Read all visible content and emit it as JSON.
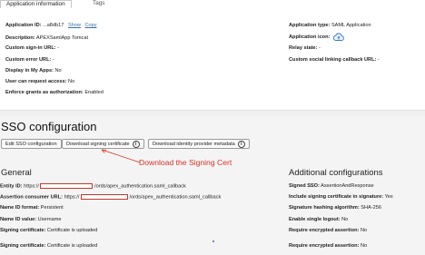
{
  "tabs": [
    {
      "label": "Application information",
      "active": true
    },
    {
      "label": "Tags",
      "active": false
    }
  ],
  "info": {
    "app_id": {
      "label": "Application ID:",
      "value": "...a8db17",
      "show": "Show",
      "copy": "Copy"
    },
    "description": {
      "label": "Description:",
      "value": "APEXSamlApp Tomcat"
    },
    "custom_signin": {
      "label": "Custom sign-in URL:",
      "value": "-"
    },
    "custom_error": {
      "label": "Custom error URL:",
      "value": "-"
    },
    "display_my_apps": {
      "label": "Display in My Apps:",
      "value": "No"
    },
    "user_request": {
      "label": "User can request access:",
      "value": "No"
    },
    "enforce_grants": {
      "label": "Enforce grants as authorization:",
      "value": "Enabled"
    },
    "app_type": {
      "label": "Application type:",
      "value": "SAML Application"
    },
    "app_icon": {
      "label": "Application icon:"
    },
    "relay_state": {
      "label": "Relay state:",
      "value": "-"
    },
    "social_callback": {
      "label": "Custom social linking callback URL:",
      "value": "-"
    }
  },
  "sso": {
    "title": "SSO configuration",
    "buttons": {
      "edit": "Edit SSO configuration",
      "download_cert": "Download signing certificate",
      "download_metadata": "Download identity provider metadata"
    },
    "annotation": "Download the Signing Cert",
    "general": {
      "title": "General",
      "entity_id": {
        "label": "Entity ID:",
        "prefix": "https://",
        "suffix": "/ords/apex_authentication.saml_callback"
      },
      "acs_url": {
        "label": "Assertion consumer URL:",
        "prefix": "https://",
        "suffix": "/ords/apex_authentication.saml_callback"
      },
      "name_id_format": {
        "label": "Name ID format:",
        "value": "Persistent"
      },
      "name_id_value": {
        "label": "Name ID value:",
        "value": "Username"
      },
      "signing_cert_1": {
        "label": "Signing certificate:",
        "value": "Certificate is uploaded"
      },
      "signing_cert_2": {
        "label": "Signing certificate:",
        "value": "Certificate is uploaded"
      }
    },
    "additional": {
      "title": "Additional configurations",
      "signed_sso": {
        "label": "Signed SSO:",
        "value": "AssertionAndResponse"
      },
      "include_cert": {
        "label": "Include signing certificate in signature:",
        "value": "Yes"
      },
      "hash_alg": {
        "label": "Signature hashing algorithm:",
        "value": "SHA-256"
      },
      "single_logout": {
        "label": "Enable single logout:",
        "value": "No"
      },
      "req_enc_1": {
        "label": "Require encrypted assertion:",
        "value": "No"
      },
      "req_enc_2": {
        "label": "Require encrypted assertion:",
        "value": "No"
      }
    }
  },
  "colors": {
    "annotation": "#d93025",
    "link": "#3a6ea5",
    "input_border": "#c0392b",
    "cloud": "#3a7cc2"
  }
}
